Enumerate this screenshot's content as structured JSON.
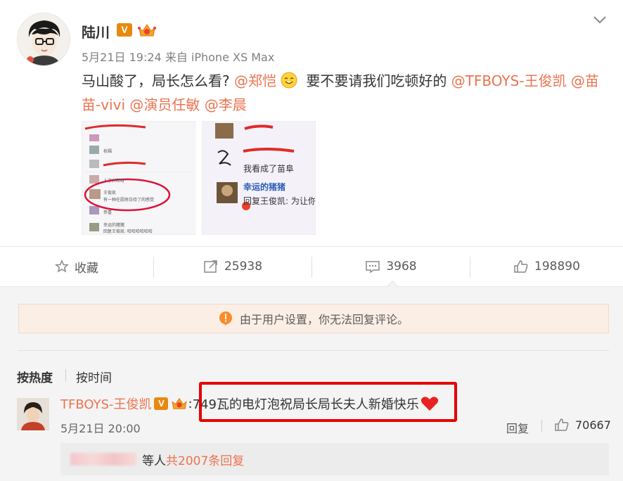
{
  "post": {
    "author": "陆川",
    "verified_mark": "V",
    "meta": "5月21日 19:24 来自 iPhone XS Max",
    "text_1": "马山酸了，局长怎么看? ",
    "mention_1": "@郑恺",
    "text_2": " 要不要请我们吃顿好的 ",
    "mention_2": "@TFBOYS-王俊凯",
    "mention_3": " @苗苗-vivi",
    "mention_4": " @演员任敏",
    "mention_5": " @李晨"
  },
  "images": {
    "right_msg_1": "我看成了苗阜",
    "right_user": "幸运的猪猪",
    "right_msg_2": "回复王俊凯: 为让你",
    "left_msg_1": "人丁兴旺呀",
    "left_user": "王俊凯",
    "left_msg_2": "有一种在厨房白待了的感觉",
    "left_msg_3": "祝福",
    "left_msg_4": "恭喜",
    "left_msg_5": "幸运的猪猪",
    "left_msg_6": "回复王俊凯: 哈哈哈哈哈哈"
  },
  "actions": {
    "favorite": "收藏",
    "repost_count": "25938",
    "comment_count": "3968",
    "like_count": "198890"
  },
  "notice": "由于用户设置，你无法回复评论。",
  "sort": {
    "hot": "按热度",
    "time": "按时间"
  },
  "comment": {
    "user": "TFBOYS-王俊凯",
    "verified_mark": "V",
    "text": "749瓦的电灯泡祝局长局长夫人新婚快乐",
    "time": "5月21日 20:00",
    "reply": "回复",
    "likes": "70667",
    "sub_reply_suffix": " 等人 ",
    "sub_reply_count": "共2007条回复"
  },
  "colors": {
    "accent": "#eb7350",
    "highlight": "#e60000",
    "badge": "#e8890f"
  }
}
